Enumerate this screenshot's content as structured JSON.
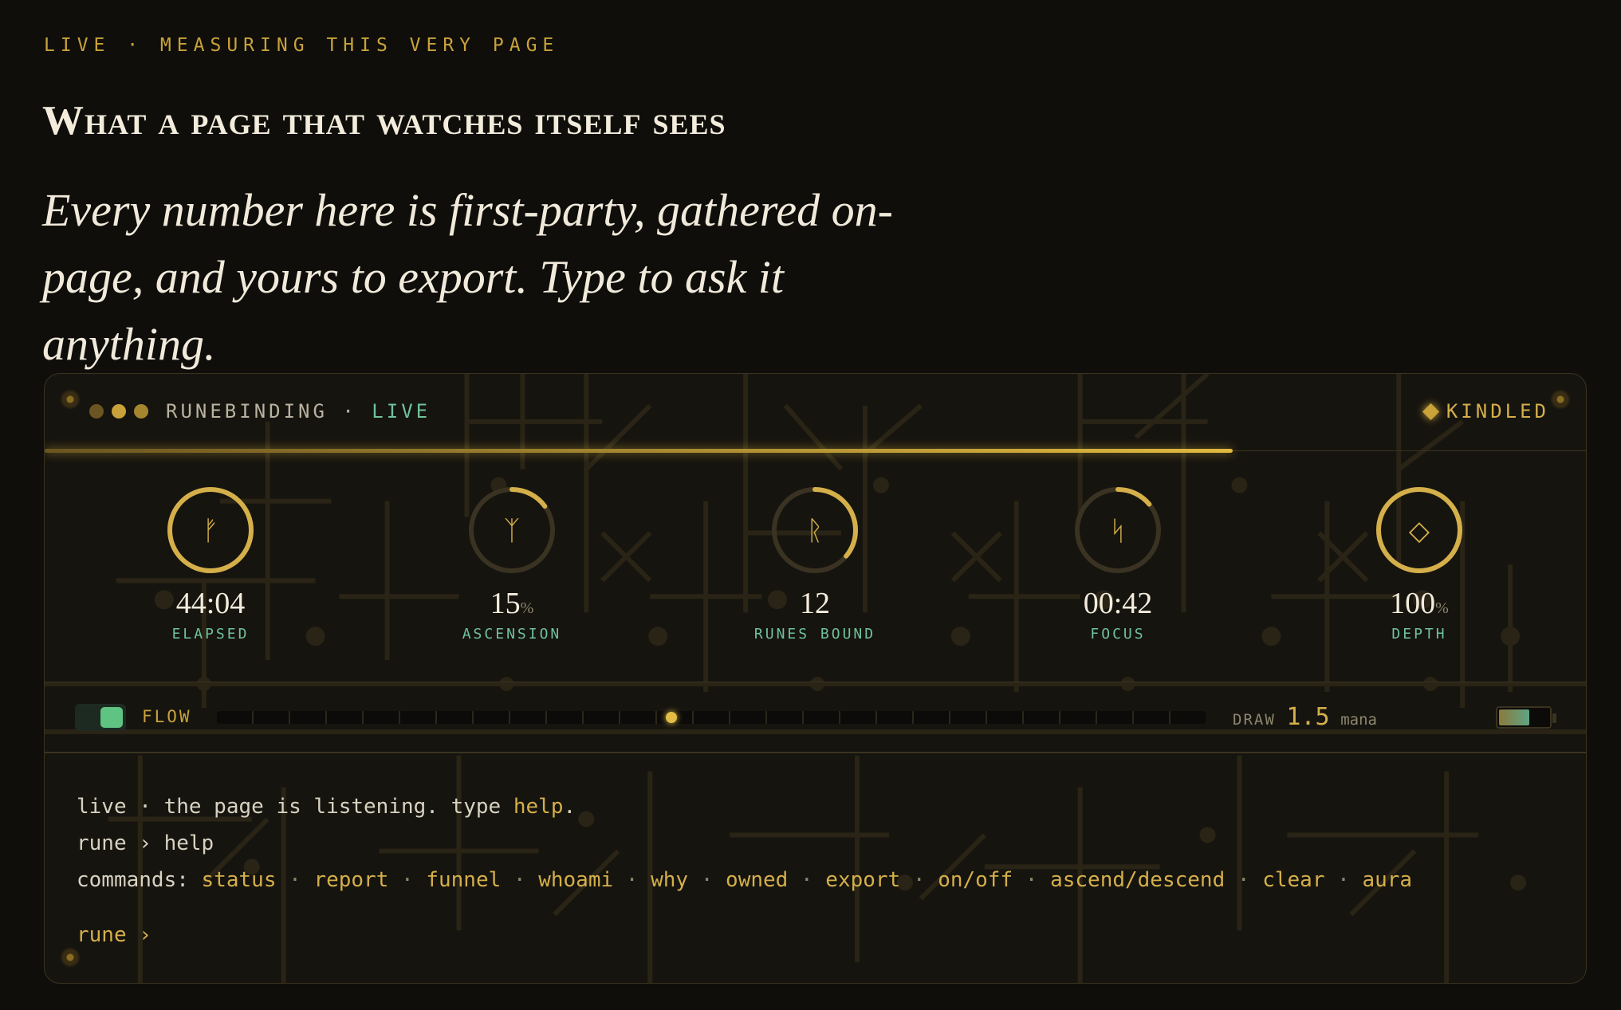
{
  "eyebrow": "LIVE · MEASURING THIS VERY PAGE",
  "headline": "What a page that watches itself sees",
  "lede": "Every number here is first-party, gathered on-page, and yours to export. Type to ask it anything.",
  "panel": {
    "title": "RUNEBINDING ·",
    "live_label": "LIVE",
    "state_label": "KINDLED",
    "session_progress": 0.77,
    "colors": {
      "accent": "#c9a23a",
      "live": "#6fc39a",
      "background": "#16140f"
    }
  },
  "gauges": [
    {
      "rune": "ᚠ",
      "value": "44:04",
      "unit": "",
      "label": "ELAPSED",
      "fill": 1.0,
      "icon": "fehu-rune-icon"
    },
    {
      "rune": "ᛉ",
      "value": "15",
      "unit": "%",
      "label": "ASCENSION",
      "fill": 0.15,
      "icon": "algiz-rune-icon"
    },
    {
      "rune": "ᚱ",
      "value": "12",
      "unit": "",
      "label": "RUNES BOUND",
      "fill": 0.36,
      "icon": "raido-rune-icon"
    },
    {
      "rune": "ᛋ",
      "value": "00:42",
      "unit": "",
      "label": "FOCUS",
      "fill": 0.14,
      "icon": "sowilo-rune-icon"
    },
    {
      "rune": "◇",
      "value": "100",
      "unit": "%",
      "label": "DEPTH",
      "fill": 1.0,
      "icon": "ingwaz-rune-icon"
    }
  ],
  "flow": {
    "label": "FLOW",
    "enabled": true,
    "position": 0.46,
    "draw_label": "DRAW",
    "draw_value": "1.5",
    "draw_unit": "mana",
    "reserve": 0.62
  },
  "console": {
    "line1_prefix": "live · the page is listening. type ",
    "line1_cmd": "help",
    "line1_suffix": ".",
    "line2": "rune › help",
    "commands_label": "commands:",
    "commands": [
      "status",
      "report",
      "funnel",
      "whoami",
      "why",
      "owned",
      "export",
      "on/off",
      "ascend/descend",
      "clear",
      "aura"
    ],
    "prompt": "rune ›"
  }
}
